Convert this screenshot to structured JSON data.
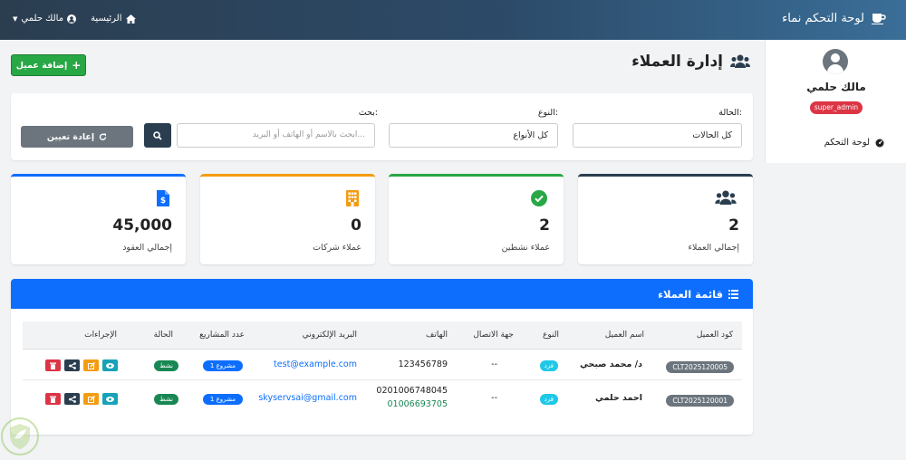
{
  "topbar": {
    "brand": "لوحة التحكم نماء",
    "user_menu": "مالك حلمي",
    "home": "الرئيسية"
  },
  "sidebar": {
    "user_name": "مالك حلمي",
    "role": "super_admin",
    "link": "لوحة التحكم"
  },
  "page": {
    "title": "إدارة العملاء",
    "add_button": "إضافة عميل"
  },
  "filters": {
    "status_label": "الحالة:",
    "status_value": "كل الحالات",
    "type_label": "النوع:",
    "type_value": "كل الأنواع",
    "search_label": "بحث:",
    "search_placeholder": "ابحث بالاسم أو الهاتف أو البريد...",
    "reset_button": "إعادة تعيين"
  },
  "stats": [
    {
      "value": "2",
      "label": "إجمالي العملاء",
      "icon": "users-icon",
      "color": "#2b3e50"
    },
    {
      "value": "2",
      "label": "عملاء نشطين",
      "icon": "check-circle-icon",
      "color": "#28a745"
    },
    {
      "value": "0",
      "label": "عملاء شركات",
      "icon": "building-icon",
      "color": "#f39c12"
    },
    {
      "value": "45,000",
      "label": "إجمالي العقود",
      "icon": "file-invoice-dollar-icon",
      "color": "#0d6efd"
    }
  ],
  "clients": {
    "title": "قائمة العملاء",
    "columns": {
      "code": "كود العميل",
      "name": "اسم العميل",
      "type": "النوع",
      "contact": "جهة الاتصال",
      "phone": "الهاتف",
      "email": "البريد الإلكتروني",
      "projects": "عدد المشاريع",
      "status": "الحالة",
      "actions": "الإجراءات"
    },
    "rows": [
      {
        "code": "CLT2025120005",
        "name": "د/ محمد صبحي",
        "type": "فرد",
        "contact": "--",
        "phone": "123456789",
        "phone2": "",
        "email": "test@example.com",
        "projects": "1 مشروع",
        "status": "نشط"
      },
      {
        "code": "CLT2025120001",
        "name": "احمد حلمي",
        "type": "فرد",
        "contact": "--",
        "phone": "0201006748045",
        "phone2": "01006693705",
        "email": "skyservsai@gmail.com",
        "projects": "1 مشروع",
        "status": "نشط"
      }
    ]
  }
}
